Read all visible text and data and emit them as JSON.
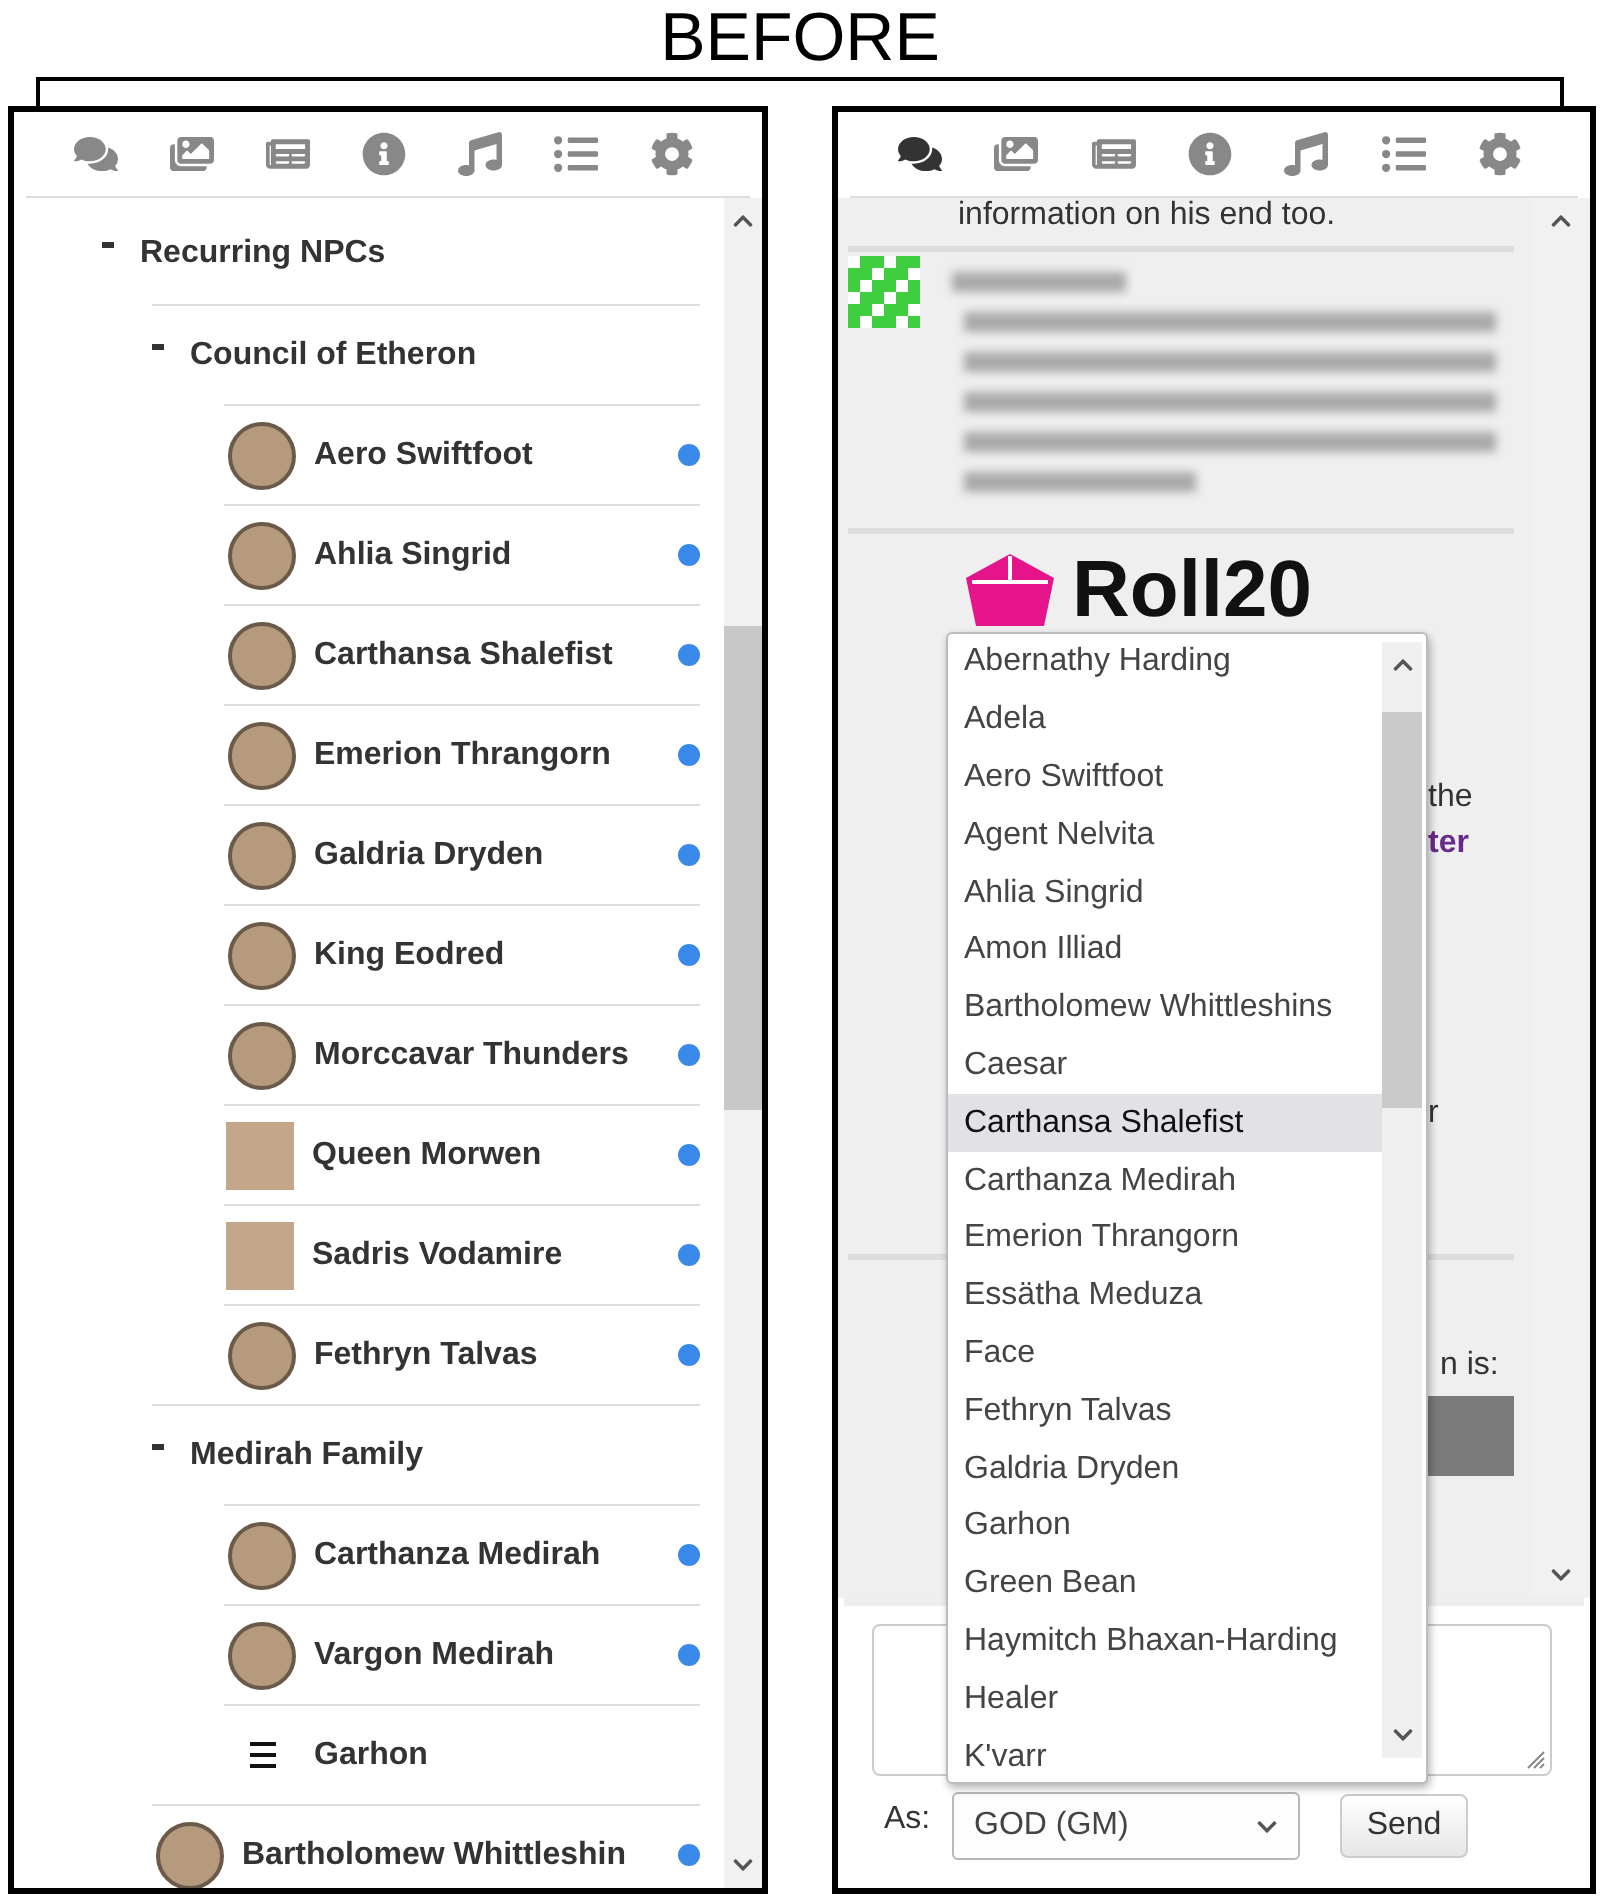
{
  "heading": "BEFORE",
  "left_panel": {
    "tabs": [
      {
        "selected": false
      },
      {
        "selected": false
      },
      {
        "selected": false
      },
      {
        "selected": false
      },
      {
        "selected": false
      },
      {
        "selected": false
      },
      {
        "selected": false
      }
    ],
    "tree": [
      {
        "kind": "folder",
        "label": "Recurring NPCs",
        "expanded": true,
        "children": [
          {
            "kind": "folder",
            "label": "Council of Etheron",
            "expanded": true,
            "children": [
              {
                "kind": "portrait",
                "name": "Aero Swiftfoot",
                "online": true
              },
              {
                "kind": "portrait",
                "name": "Ahlia Singrid",
                "online": true
              },
              {
                "kind": "portrait",
                "name": "Carthansa Shalefist",
                "online": true
              },
              {
                "kind": "portrait",
                "name": "Emerion Thrangorn",
                "online": true
              },
              {
                "kind": "portrait",
                "name": "Galdria Dryden",
                "online": true
              },
              {
                "kind": "portrait",
                "name": "King Eodred",
                "online": true
              },
              {
                "kind": "portrait",
                "name": "Morccavar Thunders",
                "online": true
              },
              {
                "kind": "picture",
                "name": "Queen Morwen",
                "online": true
              },
              {
                "kind": "picture",
                "name": "Sadris Vodamire",
                "online": true
              },
              {
                "kind": "portrait",
                "name": "Fethryn Talvas",
                "online": true
              }
            ]
          },
          {
            "kind": "folder",
            "label": "Medirah Family",
            "expanded": true,
            "children": [
              {
                "kind": "portrait",
                "name": "Carthanza Medirah",
                "online": true
              },
              {
                "kind": "portrait",
                "name": "Vargon Medirah",
                "online": true
              },
              {
                "kind": "note",
                "name": "Garhon",
                "online": false
              }
            ]
          },
          {
            "kind": "portrait",
            "name": "Bartholomew Whittleshin",
            "online": true
          }
        ]
      }
    ]
  },
  "right_panel": {
    "tabs": [
      {
        "selected": true
      },
      {
        "selected": false
      },
      {
        "selected": false
      },
      {
        "selected": false
      },
      {
        "selected": false
      },
      {
        "selected": false
      },
      {
        "selected": false
      }
    ],
    "chat": {
      "top_line": "information on his end too.",
      "logo_text": "Roll20",
      "fragments": [
        {
          "kind": "plain",
          "text": "the"
        },
        {
          "kind": "link",
          "text": "ter"
        },
        {
          "kind": "plain",
          "text": "r"
        }
      ],
      "footer_fragment": "n is:"
    },
    "speak_as": {
      "label": "As:",
      "value": "GOD (GM)",
      "expanded": true,
      "options": [
        {
          "label": "Abernathy Harding",
          "selected": false
        },
        {
          "label": "Adela",
          "selected": false
        },
        {
          "label": "Aero Swiftfoot",
          "selected": false
        },
        {
          "label": "Agent Nelvita",
          "selected": false
        },
        {
          "label": "Ahlia Singrid",
          "selected": false
        },
        {
          "label": "Amon Illiad",
          "selected": false
        },
        {
          "label": "Bartholomew Whittleshins",
          "selected": false
        },
        {
          "label": "Caesar",
          "selected": false
        },
        {
          "label": "Carthansa Shalefist",
          "selected": true
        },
        {
          "label": "Carthanza Medirah",
          "selected": false
        },
        {
          "label": "Emerion Thrangorn",
          "selected": false
        },
        {
          "label": "Essätha Meduza",
          "selected": false
        },
        {
          "label": "Face",
          "selected": false
        },
        {
          "label": "Fethryn Talvas",
          "selected": false
        },
        {
          "label": "Galdria Dryden",
          "selected": false
        },
        {
          "label": "Garhon",
          "selected": false
        },
        {
          "label": "Green Bean",
          "selected": false
        },
        {
          "label": "Haymitch Bhaxan-Harding",
          "selected": false
        },
        {
          "label": "Healer",
          "selected": false
        },
        {
          "label": "K'varr",
          "selected": false
        }
      ]
    },
    "send_button": "Send"
  }
}
